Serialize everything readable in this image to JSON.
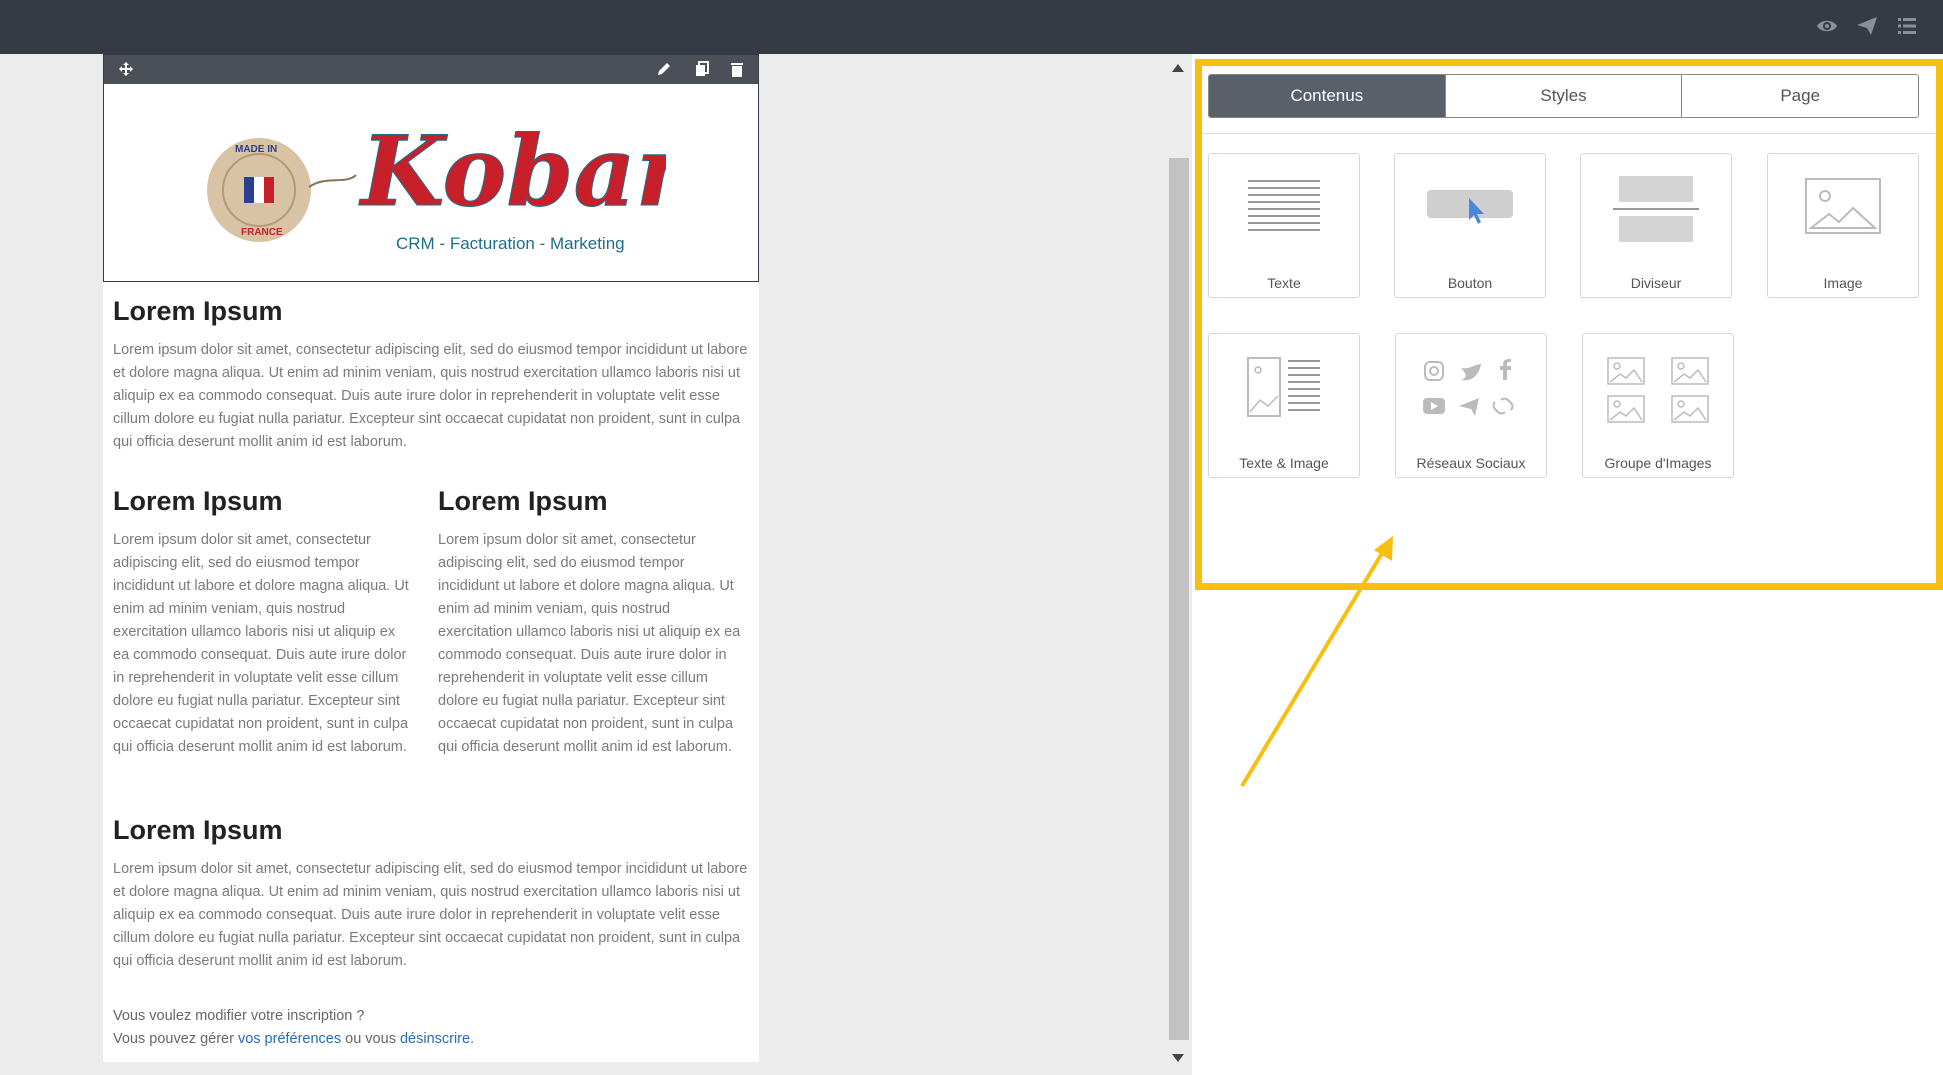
{
  "topbar": {
    "icons": [
      "eye-icon",
      "send-icon",
      "menu-icon"
    ]
  },
  "email": {
    "logo": {
      "brand": "Koban",
      "tagline": "CRM - Facturation - Marketing",
      "badge_top": "MADE IN",
      "badge_bottom": "FRANCE"
    },
    "section1": {
      "title": "Lorem Ipsum",
      "body": "Lorem ipsum dolor sit amet, consectetur adipiscing elit, sed do eiusmod tempor incididunt ut labore et dolore magna aliqua. Ut enim ad minim veniam, quis nostrud exercitation ullamco laboris nisi ut aliquip ex ea commodo consequat. Duis aute irure dolor in reprehenderit in voluptate velit esse cillum dolore eu fugiat nulla pariatur. Excepteur sint occaecat cupidatat non proident, sunt in culpa qui officia deserunt mollit anim id est laborum."
    },
    "col_left": {
      "title": "Lorem Ipsum",
      "body": "Lorem ipsum dolor sit amet, consectetur adipiscing elit, sed do eiusmod tempor incididunt ut labore et dolore magna aliqua. Ut enim ad minim veniam, quis nostrud exercitation ullamco laboris nisi ut aliquip ex ea commodo consequat. Duis aute irure dolor in reprehenderit in voluptate velit esse cillum dolore eu fugiat nulla pariatur. Excepteur sint occaecat cupidatat non proident, sunt in culpa qui officia deserunt mollit anim id est laborum."
    },
    "col_right": {
      "title": "Lorem Ipsum",
      "body": "Lorem ipsum dolor sit amet, consectetur adipiscing elit, sed do eiusmod tempor incididunt ut labore et dolore magna aliqua. Ut enim ad minim veniam, quis nostrud exercitation ullamco laboris nisi ut aliquip ex ea commodo consequat. Duis aute irure dolor in reprehenderit in voluptate velit esse cillum dolore eu fugiat nulla pariatur. Excepteur sint occaecat cupidatat non proident, sunt in culpa qui officia deserunt mollit anim id est laborum."
    },
    "section3": {
      "title": "Lorem Ipsum",
      "body": "Lorem ipsum dolor sit amet, consectetur adipiscing elit, sed do eiusmod tempor incididunt ut labore et dolore magna aliqua. Ut enim ad minim veniam, quis nostrud exercitation ullamco laboris nisi ut aliquip ex ea commodo consequat. Duis aute irure dolor in reprehenderit in voluptate velit esse cillum dolore eu fugiat nulla pariatur. Excepteur sint occaecat cupidatat non proident, sunt in culpa qui officia deserunt mollit anim id est laborum."
    },
    "footer": {
      "line1": "Vous voulez modifier votre inscription ?",
      "line2_pre": "Vous pouvez gérer ",
      "link_prefs": "vos préférences",
      "line2_mid": " ou vous ",
      "link_unsub": "désinscrire",
      "line2_end": "."
    }
  },
  "panel": {
    "tabs": [
      "Contenus",
      "Styles",
      "Page"
    ],
    "active_tab": "Contenus",
    "tiles": [
      "Texte",
      "Bouton",
      "Diviseur",
      "Image",
      "Texte & Image",
      "Réseaux Sociaux",
      "Groupe d'Images"
    ]
  },
  "colors": {
    "topbar": "#353b45",
    "highlight": "#f8bf0e",
    "active_tab": "#5a6069",
    "link": "#2a6bb5",
    "brand_red": "#c8202b",
    "brand_teal": "#1b6f8a"
  }
}
